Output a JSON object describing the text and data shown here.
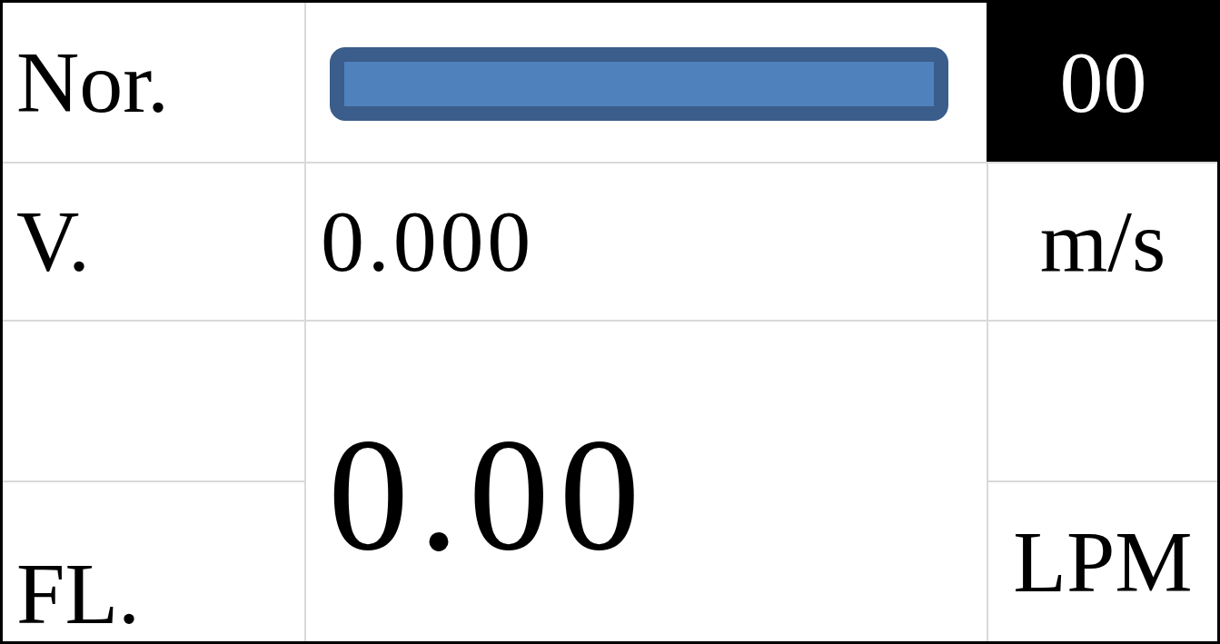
{
  "status": {
    "label": "Nor.",
    "level": 1,
    "code": "00"
  },
  "velocity": {
    "label": "V.",
    "value": "0.000",
    "unit": "m/s"
  },
  "flow": {
    "label": "FL.",
    "value": "0.00",
    "unit": "LPM"
  }
}
